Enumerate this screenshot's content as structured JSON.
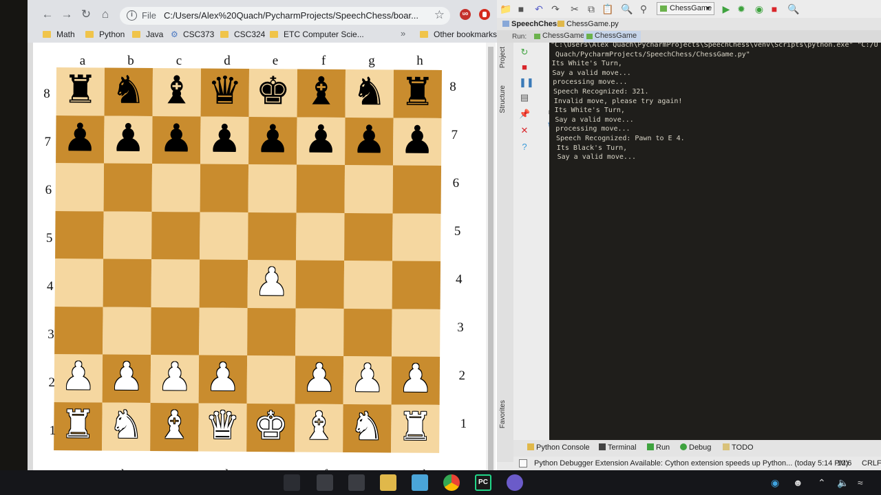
{
  "browser": {
    "back_icon": "arrow-left-icon",
    "forward_icon": "arrow-right-icon",
    "reload_icon": "reload-icon",
    "home_icon": "home-icon",
    "scheme": "File",
    "url": "C:/Users/Alex%20Quach/PycharmProjects/SpeechChess/boar...",
    "bookmarks": [
      "Math",
      "Python",
      "Java",
      "CSC373",
      "CSC324",
      "ETC Computer Scie..."
    ],
    "more_bookmarks": "»",
    "other_bookmarks": "Other bookmarks"
  },
  "board": {
    "files": [
      "a",
      "b",
      "c",
      "d",
      "e",
      "f",
      "g",
      "h"
    ],
    "ranks": [
      "8",
      "7",
      "6",
      "5",
      "4",
      "3",
      "2",
      "1"
    ],
    "rows": [
      [
        "br",
        "bn",
        "bb",
        "bq",
        "bk",
        "bb",
        "bn",
        "br"
      ],
      [
        "bp",
        "bp",
        "bp",
        "bp",
        "bp",
        "bp",
        "bp",
        "bp"
      ],
      [
        "",
        "",
        "",
        "",
        "",
        "",
        "",
        ""
      ],
      [
        "",
        "",
        "",
        "",
        "",
        "",
        "",
        ""
      ],
      [
        "",
        "",
        "",
        "",
        "wp",
        "",
        "",
        ""
      ],
      [
        "",
        "",
        "",
        "",
        "",
        "",
        "",
        ""
      ],
      [
        "wp",
        "wp",
        "wp",
        "wp",
        "",
        "wp",
        "wp",
        "wp"
      ],
      [
        "wr",
        "wn",
        "wb",
        "wq",
        "wk",
        "wb",
        "wn",
        "wr"
      ]
    ],
    "light_color": "#f5d7a0",
    "dark_color": "#c98c2e"
  },
  "pycharm": {
    "run_config": "ChessGame",
    "breadcrumb": [
      "SpeechChess",
      "ChessGame.py"
    ],
    "run_label": "Run:",
    "tabs": [
      "ChessGame",
      "ChessGame"
    ],
    "side_tabs": {
      "project": "Project",
      "structure": "Structure",
      "favorites": "Favorites"
    },
    "console_lines": [
      "\"C:\\Users\\Alex Quach\\PycharmProjects\\SpeechChess\\venv\\Scripts\\python.exe\" \"C:/U",
      " Quach/PycharmProjects/SpeechChess/ChessGame.py\"",
      "Its White's Turn,",
      "Say a valid move...",
      "processing move...",
      "Speech Recognized: 321.",
      "Invalid move, please try again!",
      "Its White's Turn,",
      "Say a valid move...",
      "processing move...",
      "Speech Recognized: Pawn to E 4.",
      "Its Black's Turn,",
      "Say a valid move..."
    ],
    "bottom_tabs": [
      "Python Console",
      "Terminal",
      "Run",
      "Debug",
      "TODO"
    ],
    "status_message": "Python Debugger Extension Available: Cython extension speeds up Python... (today 5:14 PM)",
    "status_position": "10:6",
    "status_lineend": "CRLF"
  }
}
